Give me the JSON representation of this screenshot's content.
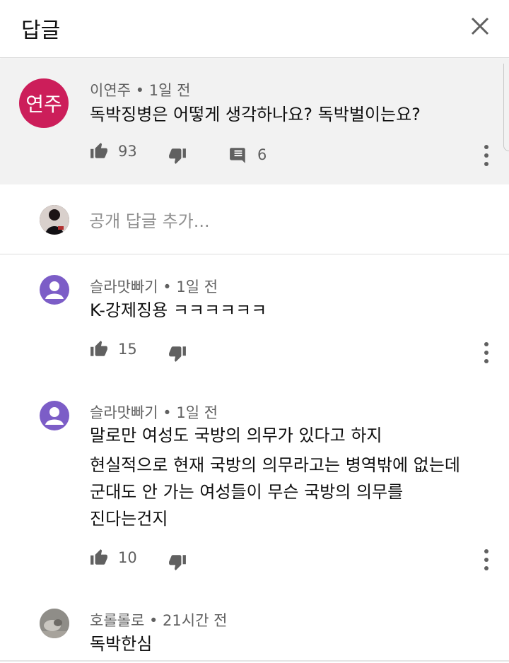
{
  "header": {
    "title": "답글",
    "close_icon": "close-icon"
  },
  "colors": {
    "parent_bg": "#f2f2f2",
    "avatar_pink": "#cc1e5a",
    "avatar_purple": "#7c5dc7",
    "meta_gray": "#606060"
  },
  "parent": {
    "avatar_text": "연주",
    "author": "이연주",
    "time": "1일 전",
    "text": "독박징병은 어떻게 생각하나요? 독박벌이는요?",
    "likes": "93",
    "replies": "6"
  },
  "reply_box": {
    "placeholder": "공개 답글 추가..."
  },
  "replies": [
    {
      "author": "슬라맛빠기",
      "time": "1일 전",
      "lines": [
        "K-강제징용 ㅋㅋㅋㅋㅋㅋ"
      ],
      "likes": "15"
    },
    {
      "author": "슬라맛빠기",
      "time": "1일 전",
      "lines": [
        "말로만 여성도 국방의 의무가 있다고 하지",
        "현실적으로 현재 국방의 의무라고는 병역밖에 없는데",
        "군대도 안 가는 여성들이 무슨 국방의 의무를",
        "진다는건지"
      ],
      "likes": "10"
    },
    {
      "author": "호롤롤로",
      "time": "21시간 전",
      "lines": [
        "독박한심"
      ]
    }
  ],
  "separator": "•"
}
